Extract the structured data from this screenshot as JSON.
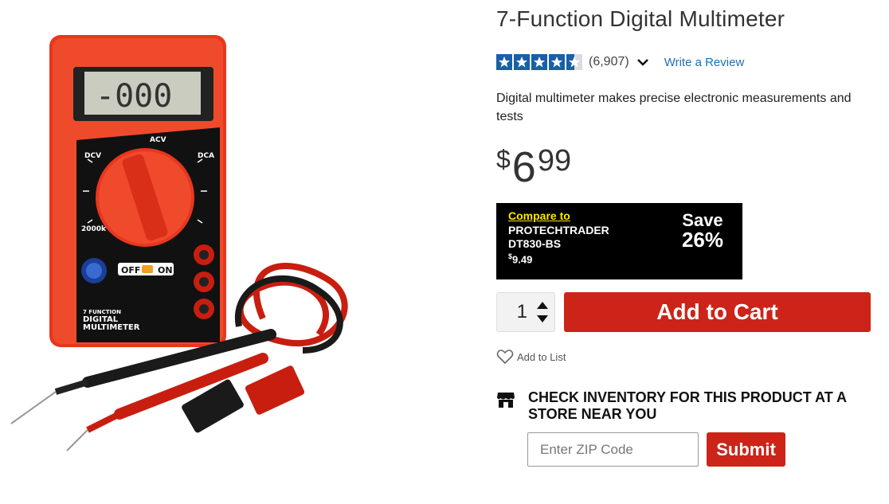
{
  "product": {
    "title": "7-Function Digital Multimeter",
    "rating": 4.5,
    "review_count": "(6,907)",
    "write_review": "Write a Review",
    "description": "Digital multimeter makes precise electronic measurements and tests",
    "price": {
      "currency": "$",
      "dollars": "6",
      "cents": "99"
    },
    "image": {
      "lcd_text": "-000",
      "label_line1": "7 FUNCTION",
      "label_line2": "DIGITAL",
      "label_line3": "MULTIMETER",
      "off_label": "OFF",
      "on_label": "ON"
    }
  },
  "compare": {
    "link_text": "Compare to",
    "competitor": "PROTECHTRADER DT830-BS",
    "competitor_price_symbol": "$",
    "competitor_price": "9.49",
    "save_label": "Save",
    "save_percent": "26%"
  },
  "cart": {
    "quantity": "1",
    "add_to_cart_label": "Add to Cart",
    "add_to_list_label": "Add to List"
  },
  "inventory": {
    "heading": "CHECK INVENTORY FOR THIS PRODUCT AT A STORE NEAR YOU",
    "zip_placeholder": "Enter ZIP Code",
    "submit_label": "Submit"
  },
  "colors": {
    "accent_red": "#cc2418",
    "link_blue": "#1f6fb2",
    "star_blue": "#1a5fa8",
    "compare_yellow": "#ffe600"
  }
}
